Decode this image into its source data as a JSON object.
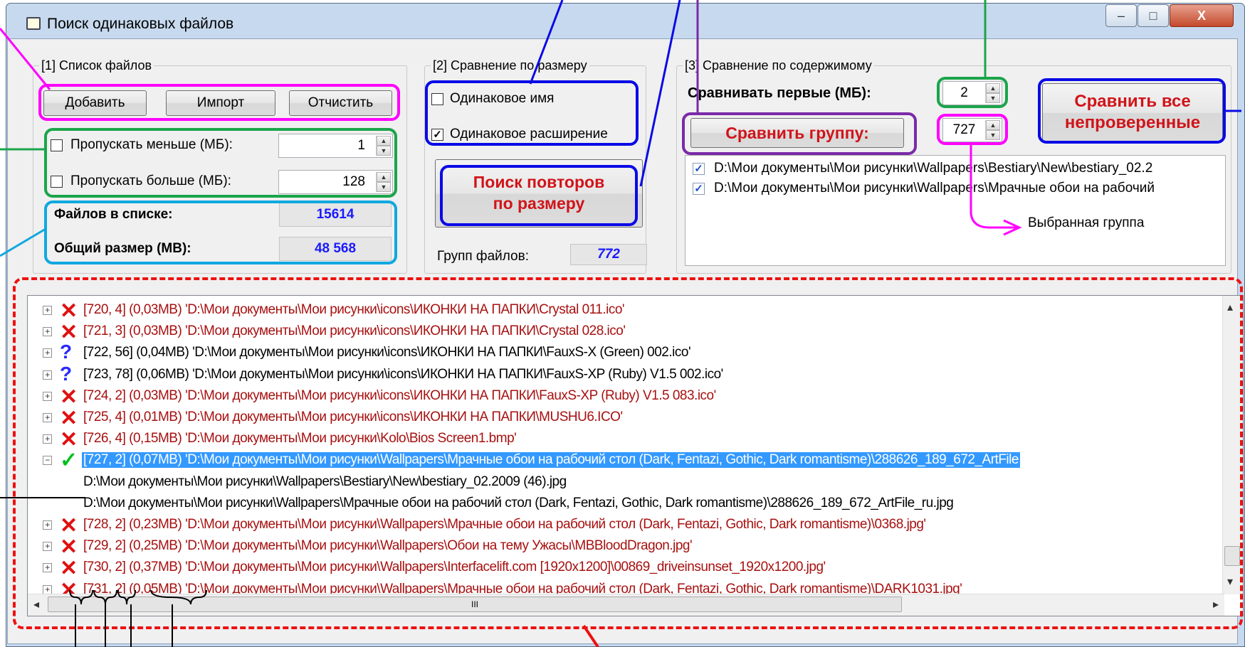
{
  "window": {
    "title": "Поиск одинаковых файлов"
  },
  "caption_buttons": {
    "minimize": "–",
    "maximize": "□",
    "close": "X"
  },
  "group1": {
    "legend": "[1] Список файлов",
    "btn_add": "Добавить",
    "btn_import": "Импорт",
    "btn_clear": "Отчистить",
    "skip_less_label": "Пропускать меньше (МБ):",
    "skip_less_value": "1",
    "skip_more_label": "Пропускать больше (МБ):",
    "skip_more_value": "128",
    "files_label": "Файлов в списке:",
    "files_value": "15614",
    "size_label": "Общий размер (MB):",
    "size_value": "48 568"
  },
  "group2": {
    "legend": "[2] Сравнение по размеру",
    "same_name_label": "Одинаковое имя",
    "same_name_checked": false,
    "same_ext_label": "Одинаковое расширение",
    "same_ext_checked": true,
    "search_btn_line1": "Поиск повторов",
    "search_btn_line2": "по размеру",
    "groups_label": "Групп файлов:",
    "groups_value": "772"
  },
  "group3": {
    "legend": "[3] Сравнение по содержимому",
    "compare_first_label": "Сравнивать первые (МБ):",
    "compare_first_value": "2",
    "compare_group_btn": "Сравнить группу:",
    "group_number": "727",
    "compare_all_line1": "Сравнить все",
    "compare_all_line2": "непроверенные",
    "list_items": [
      "D:\\Мои документы\\Мои рисунки\\Wallpapers\\Bestiary\\New\\bestiary_02.2",
      "D:\\Мои документы\\Мои рисунки\\Wallpapers\\Мрачные обои на рабочий"
    ]
  },
  "annotation": {
    "selected_group": "Выбранная группа"
  },
  "tree": {
    "rows": [
      {
        "icon": "x",
        "text": "[720, 4] (0,03MB) 'D:\\Мои документы\\Мои рисунки\\icons\\ИКОНКИ НА ПАПКИ\\Crystal 011.ico'"
      },
      {
        "icon": "x",
        "text": "[721, 3] (0,03MB) 'D:\\Мои документы\\Мои рисунки\\icons\\ИКОНКИ НА ПАПКИ\\Crystal 028.ico'"
      },
      {
        "icon": "q",
        "text": "[722, 56] (0,04MB) 'D:\\Мои документы\\Мои рисунки\\icons\\ИКОНКИ НА ПАПКИ\\FauxS-X (Green) 002.ico'"
      },
      {
        "icon": "q",
        "text": "[723, 78] (0,06MB) 'D:\\Мои документы\\Мои рисунки\\icons\\ИКОНКИ НА ПАПКИ\\FauxS-XP (Ruby) V1.5 002.ico'"
      },
      {
        "icon": "x",
        "text": "[724, 2] (0,03MB) 'D:\\Мои документы\\Мои рисунки\\icons\\ИКОНКИ НА ПАПКИ\\FauxS-XP (Ruby) V1.5 083.ico'"
      },
      {
        "icon": "x",
        "text": "[725, 4] (0,01MB) 'D:\\Мои документы\\Мои рисунки\\icons\\ИКОНКИ НА ПАПКИ\\MUSHU6.ICO'"
      },
      {
        "icon": "x",
        "text": "[726, 4] (0,15MB) 'D:\\Мои документы\\Мои рисунки\\Kolo\\Bios Screen1.bmp'"
      },
      {
        "icon": "v",
        "text": "[727, 2] (0,07MB) 'D:\\Мои документы\\Мои рисунки\\Wallpapers\\Мрачные обои на рабочий стол (Dark, Fentazi, Gothic, Dark romantisme)\\288626_189_672_ArtFile"
      },
      {
        "icon": "",
        "text": "D:\\Мои документы\\Мои рисунки\\Wallpapers\\Bestiary\\New\\bestiary_02.2009 (46).jpg"
      },
      {
        "icon": "",
        "text": "D:\\Мои документы\\Мои рисунки\\Wallpapers\\Мрачные обои на рабочий стол (Dark, Fentazi, Gothic, Dark romantisme)\\288626_189_672_ArtFile_ru.jpg"
      },
      {
        "icon": "x",
        "text": "[728, 2] (0,23MB) 'D:\\Мои документы\\Мои рисунки\\Wallpapers\\Мрачные обои на рабочий стол (Dark, Fentazi, Gothic, Dark romantisme)\\0368.jpg'"
      },
      {
        "icon": "x",
        "text": "[729, 2] (0,25MB) 'D:\\Мои документы\\Мои рисунки\\Wallpapers\\Обои на тему Ужасы\\MBBloodDragon.jpg'"
      },
      {
        "icon": "x",
        "text": "[730, 2] (0,37MB) 'D:\\Мои документы\\Мои рисунки\\Wallpapers\\Interfacelift.com [1920x1200]\\00869_driveinsunset_1920x1200.jpg'"
      },
      {
        "icon": "x",
        "text": "[731, 2] (0,05MB) 'D:\\Мои документы\\Мои рисунки\\Wallpapers\\Мрачные обои на рабочий стол (Dark, Fentazi, Gothic, Dark romantisme)\\DARK1031.jpg'"
      }
    ]
  },
  "scroll": {
    "grip": "III",
    "left_arrow": "◂",
    "right_arrow": "▸",
    "up_arrow": "▴",
    "down_arrow": "▾"
  },
  "colors": {
    "annotation_magenta": "#ff00ff",
    "annotation_green": "#1aa54a",
    "annotation_cyan": "#10a8e0",
    "annotation_blue": "#0a0ae6",
    "annotation_purple": "#7a2aa8",
    "annotation_red_dashed": "#ee1111",
    "selection": "#3399ff"
  }
}
